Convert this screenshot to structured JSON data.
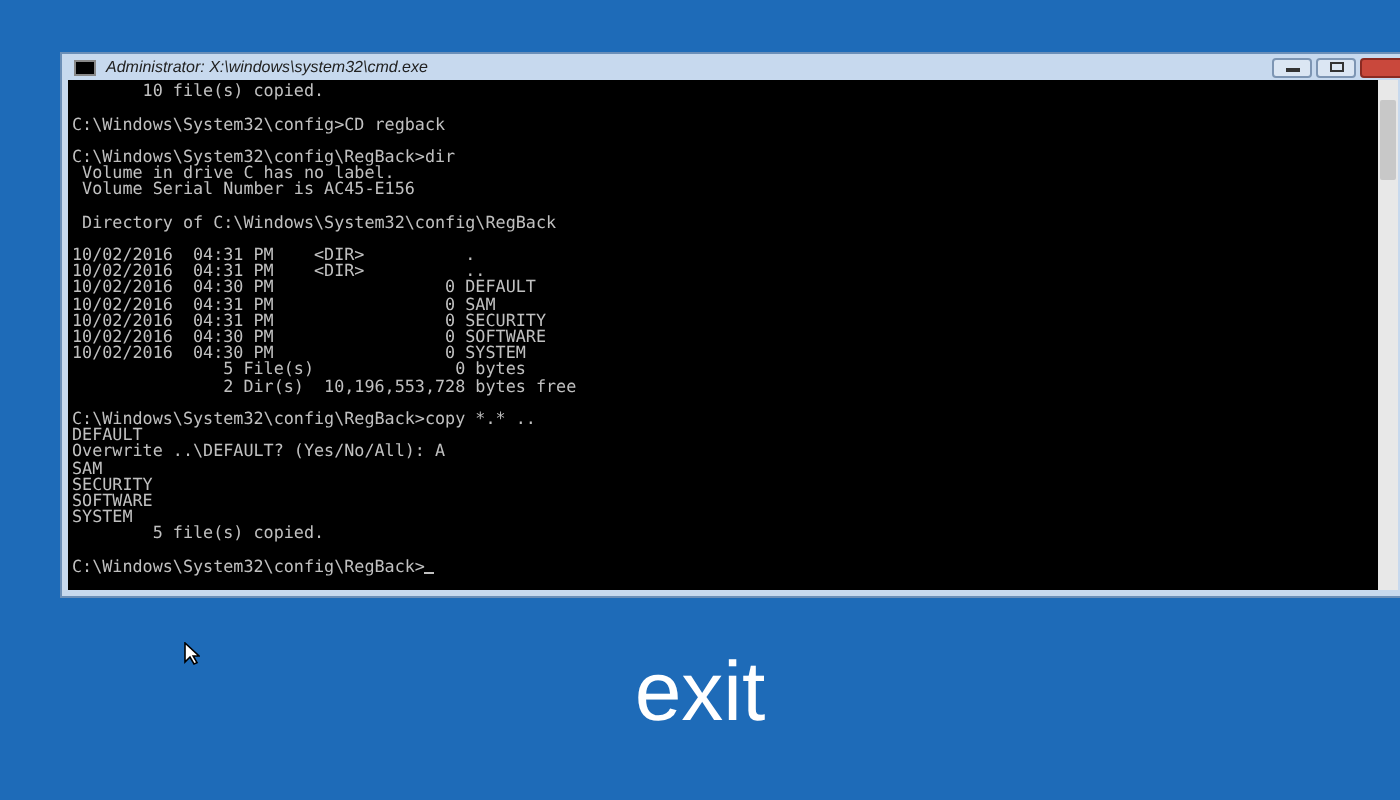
{
  "window": {
    "title": "Administrator: X:\\windows\\system32\\cmd.exe"
  },
  "console": {
    "cursor": true,
    "blocks": [
      {
        "lines": [
          "       10 file(s) copied."
        ]
      },
      {
        "lines": [
          "C:\\Windows\\System32\\config>CD regback"
        ]
      },
      {
        "lines": [
          "C:\\Windows\\System32\\config\\RegBack>dir",
          " Volume in drive C has no label.",
          " Volume Serial Number is AC45-E156"
        ]
      },
      {
        "lines": [
          " Directory of C:\\Windows\\System32\\config\\RegBack"
        ]
      },
      {
        "lines": [
          "10/02/2016  04:31 PM    <DIR>          .",
          "10/02/2016  04:31 PM    <DIR>          ..",
          "10/02/2016  04:30 PM                 0 DEFAULT",
          "10/02/2016  04:31 PM                 0 SAM",
          "10/02/2016  04:31 PM                 0 SECURITY",
          "10/02/2016  04:30 PM                 0 SOFTWARE",
          "10/02/2016  04:30 PM                 0 SYSTEM",
          "               5 File(s)              0 bytes",
          "               2 Dir(s)  10,196,553,728 bytes free"
        ]
      },
      {
        "lines": [
          "C:\\Windows\\System32\\config\\RegBack>copy *.* ..",
          "DEFAULT",
          "Overwrite ..\\DEFAULT? (Yes/No/All): A",
          "SAM",
          "SECURITY",
          "SOFTWARE",
          "SYSTEM",
          "        5 file(s) copied."
        ]
      },
      {
        "lines": [
          "C:\\Windows\\System32\\config\\RegBack>"
        ]
      }
    ]
  },
  "caption": "exit"
}
